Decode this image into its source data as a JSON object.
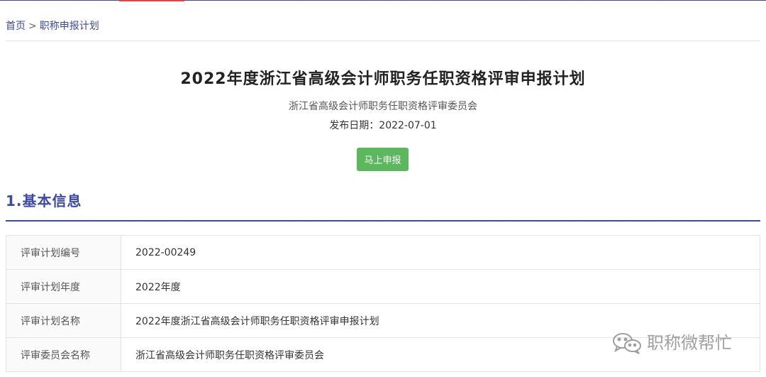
{
  "breadcrumb": {
    "home": "首页",
    "separator": ">",
    "current": "职称申报计划"
  },
  "plan": {
    "title": "2022年度浙江省高级会计师职务任职资格评审申报计划",
    "committee": "浙江省高级会计师职务任职资格评审委员会",
    "publish_date": "发布日期：2022-07-01",
    "apply_button": "马上申报"
  },
  "section1": {
    "title": "1.基本信息",
    "rows": [
      {
        "label": "评审计划编号",
        "value": "2022-00249"
      },
      {
        "label": "评审计划年度",
        "value": "2022年度"
      },
      {
        "label": "评审计划名称",
        "value": "2022年度浙江省高级会计师职务任职资格评审申报计划"
      },
      {
        "label": "评审委员会名称",
        "value": "浙江省高级会计师职务任职资格评审委员会"
      }
    ]
  },
  "watermark": {
    "icon": "wechat-icon",
    "text": "职称微帮忙"
  },
  "colors": {
    "accent": "#3b4aa8",
    "button": "#5cb85c",
    "top_tab_accent": "#e04545"
  }
}
